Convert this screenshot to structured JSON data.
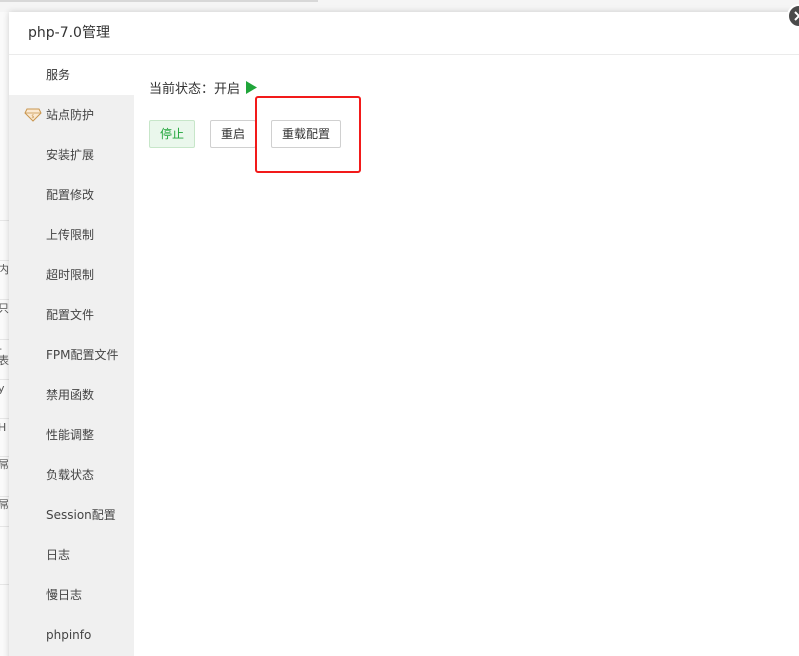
{
  "dialog": {
    "title": "php-7.0管理"
  },
  "sidebar": {
    "items": [
      {
        "label": "服务"
      },
      {
        "label": "站点防护"
      },
      {
        "label": "安装扩展"
      },
      {
        "label": "配置修改"
      },
      {
        "label": "上传限制"
      },
      {
        "label": "超时限制"
      },
      {
        "label": "配置文件"
      },
      {
        "label": "FPM配置文件"
      },
      {
        "label": "禁用函数"
      },
      {
        "label": "性能调整"
      },
      {
        "label": "负载状态"
      },
      {
        "label": "Session配置"
      },
      {
        "label": "日志"
      },
      {
        "label": "慢日志"
      },
      {
        "label": "phpinfo"
      }
    ]
  },
  "status": {
    "label": "当前状态：开启",
    "icon": "play-icon",
    "color": "#20a53a"
  },
  "buttons": {
    "stop": "停止",
    "restart": "重启",
    "reload": "重载配置"
  },
  "background_fragments": [
    "内",
    "只",
    "-表",
    "y",
    "H",
    "屌",
    "屌"
  ],
  "colors": {
    "accent_green": "#20a53a",
    "highlight_red": "#f21a1a",
    "sidebar_bg": "#f0f0f0"
  }
}
